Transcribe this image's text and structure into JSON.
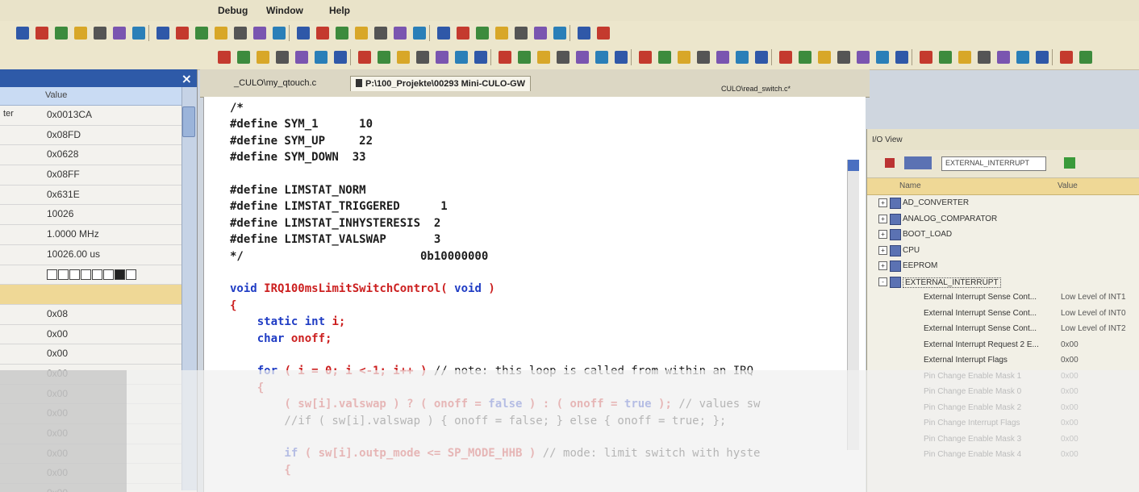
{
  "menu": {
    "items": [
      "Debug",
      "Window",
      "Help"
    ]
  },
  "watch": {
    "header": {
      "name": "",
      "value": "Value"
    },
    "rows": [
      {
        "name": "ter",
        "value": "0x0013CA"
      },
      {
        "name": "",
        "value": "0x08FD"
      },
      {
        "name": "",
        "value": "0x0628"
      },
      {
        "name": "",
        "value": "0x08FF"
      },
      {
        "name": "",
        "value": "0x631E"
      },
      {
        "name": "",
        "value": "10026"
      },
      {
        "name": "",
        "value": "1.0000 MHz"
      },
      {
        "name": "",
        "value": "10026.00 us"
      },
      {
        "name": "",
        "value": "",
        "bits": [
          0,
          0,
          0,
          0,
          0,
          0,
          1,
          0
        ]
      },
      {
        "name": "",
        "value": "",
        "selected": true
      },
      {
        "name": "",
        "value": "0x08"
      },
      {
        "name": "",
        "value": "0x00"
      },
      {
        "name": "",
        "value": "0x00"
      },
      {
        "name": "",
        "value": "0x00"
      },
      {
        "name": "",
        "value": "0x00"
      },
      {
        "name": "",
        "value": "0x00"
      },
      {
        "name": "",
        "value": "0x00"
      },
      {
        "name": "",
        "value": "0x00"
      },
      {
        "name": "",
        "value": "0x00"
      },
      {
        "name": "",
        "value": "0x00"
      }
    ]
  },
  "tabs": [
    {
      "label": "_CULO\\my_qtouch.c",
      "active": false
    },
    {
      "label": "P:\\100_Projekte\\00293 Mini-CULO-GW",
      "active": true
    },
    {
      "label": "CULO\\read_switch.c*",
      "active": false
    }
  ],
  "code": [
    {
      "t": [
        {
          "c": "dflt",
          "s": "/*"
        }
      ]
    },
    {
      "t": [
        {
          "c": "dflt",
          "s": "#define SYM_1      10"
        }
      ]
    },
    {
      "t": [
        {
          "c": "dflt",
          "s": "#define SYM_UP     22"
        }
      ]
    },
    {
      "t": [
        {
          "c": "dflt",
          "s": "#define SYM_DOWN  33"
        }
      ]
    },
    {
      "t": [
        {
          "c": "dflt",
          "s": ""
        }
      ]
    },
    {
      "t": [
        {
          "c": "dflt",
          "s": "#define LIMSTAT_NORM"
        }
      ]
    },
    {
      "t": [
        {
          "c": "dflt",
          "s": "#define LIMSTAT_TRIGGERED      1"
        }
      ]
    },
    {
      "t": [
        {
          "c": "dflt",
          "s": "#define LIMSTAT_INHYSTERESIS  2"
        }
      ]
    },
    {
      "t": [
        {
          "c": "dflt",
          "s": "#define LIMSTAT_VALSWAP       3"
        }
      ]
    },
    {
      "t": [
        {
          "c": "dflt",
          "s": "*/                          0b10000000"
        }
      ]
    },
    {
      "t": [
        {
          "c": "dflt",
          "s": ""
        }
      ]
    },
    {
      "t": [
        {
          "c": "kw",
          "s": "void "
        },
        {
          "c": "fn",
          "s": "IRQ100msLimitSwitchControl( "
        },
        {
          "c": "kw",
          "s": "void"
        },
        {
          "c": "fn",
          "s": " )"
        }
      ]
    },
    {
      "t": [
        {
          "c": "fn",
          "s": "{"
        }
      ]
    },
    {
      "t": [
        {
          "c": "kw",
          "s": "    static int "
        },
        {
          "c": "fn",
          "s": "i;"
        }
      ]
    },
    {
      "t": [
        {
          "c": "kw",
          "s": "    char "
        },
        {
          "c": "fn",
          "s": "onoff;"
        }
      ]
    },
    {
      "t": [
        {
          "c": "dflt",
          "s": ""
        }
      ]
    },
    {
      "t": [
        {
          "c": "kw",
          "s": "    for "
        },
        {
          "c": "fn",
          "s": "( i = 0; i <-1; i++ ) "
        },
        {
          "c": "cm",
          "s": "// note: this loop is called from within an IRQ"
        }
      ]
    },
    {
      "t": [
        {
          "c": "fn",
          "s": "    {"
        }
      ]
    },
    {
      "t": [
        {
          "c": "fn",
          "s": "        ( sw[i].valswap ) ? ( onoff = "
        },
        {
          "c": "kw",
          "s": "false"
        },
        {
          "c": "fn",
          "s": " ) : ( onoff = "
        },
        {
          "c": "kw",
          "s": "true"
        },
        {
          "c": "fn",
          "s": " ); "
        },
        {
          "c": "cm",
          "s": "// values sw"
        }
      ]
    },
    {
      "t": [
        {
          "c": "cm",
          "s": "        //if ( sw[i].valswap ) { onoff = false; } else { onoff = true; };"
        }
      ]
    },
    {
      "t": [
        {
          "c": "dflt",
          "s": ""
        }
      ]
    },
    {
      "t": [
        {
          "c": "kw",
          "s": "        if "
        },
        {
          "c": "fn",
          "s": "( sw[i].outp_mode <= SP_MODE_HHB ) "
        },
        {
          "c": "cm",
          "s": "// mode: limit switch with hyste"
        }
      ]
    },
    {
      "t": [
        {
          "c": "fn",
          "s": "        {"
        }
      ]
    }
  ],
  "io_view": {
    "title": "I/O View",
    "dropdown": "EXTERNAL_INTERRUPT",
    "cols": {
      "name": "Name",
      "value": "Value"
    },
    "items": [
      {
        "label": "AD_CONVERTER",
        "expander": "+",
        "child": false
      },
      {
        "label": "ANALOG_COMPARATOR",
        "expander": "+",
        "child": false
      },
      {
        "label": "BOOT_LOAD",
        "expander": "+",
        "child": false
      },
      {
        "label": "CPU",
        "expander": "+",
        "child": false
      },
      {
        "label": "EEPROM",
        "expander": "+",
        "child": false
      },
      {
        "label": "EXTERNAL_INTERRUPT",
        "expander": "-",
        "child": false,
        "selected": true
      },
      {
        "label": "External Interrupt Sense Cont...",
        "value": "Low Level of INT1",
        "child": true
      },
      {
        "label": "External Interrupt Sense Cont...",
        "value": "Low Level of INT0",
        "child": true
      },
      {
        "label": "External Interrupt Sense Cont...",
        "value": "Low Level of INT2",
        "child": true
      },
      {
        "label": "External Interrupt Request 2 E...",
        "value": "0x00",
        "child": true
      },
      {
        "label": "External Interrupt Flags",
        "value": "0x00",
        "child": true
      },
      {
        "label": "Pin Change Enable Mask 1",
        "value": "0x00",
        "child": true
      },
      {
        "label": "Pin Change Enable Mask 0",
        "value": "0x00",
        "child": true
      },
      {
        "label": "Pin Change Enable Mask 2",
        "value": "0x00",
        "child": true
      },
      {
        "label": "Pin Change Interrupt Flags",
        "value": "0x00",
        "child": true
      },
      {
        "label": "Pin Change Enable Mask 3",
        "value": "0x00",
        "child": true
      },
      {
        "label": "Pin Change Enable Mask 4",
        "value": "0x00",
        "child": true
      }
    ]
  },
  "colors": {
    "panel_title": "#2e5aa8",
    "keyword": "#1f3cc4",
    "identifier": "#cc2020",
    "selection": "#efd896"
  }
}
